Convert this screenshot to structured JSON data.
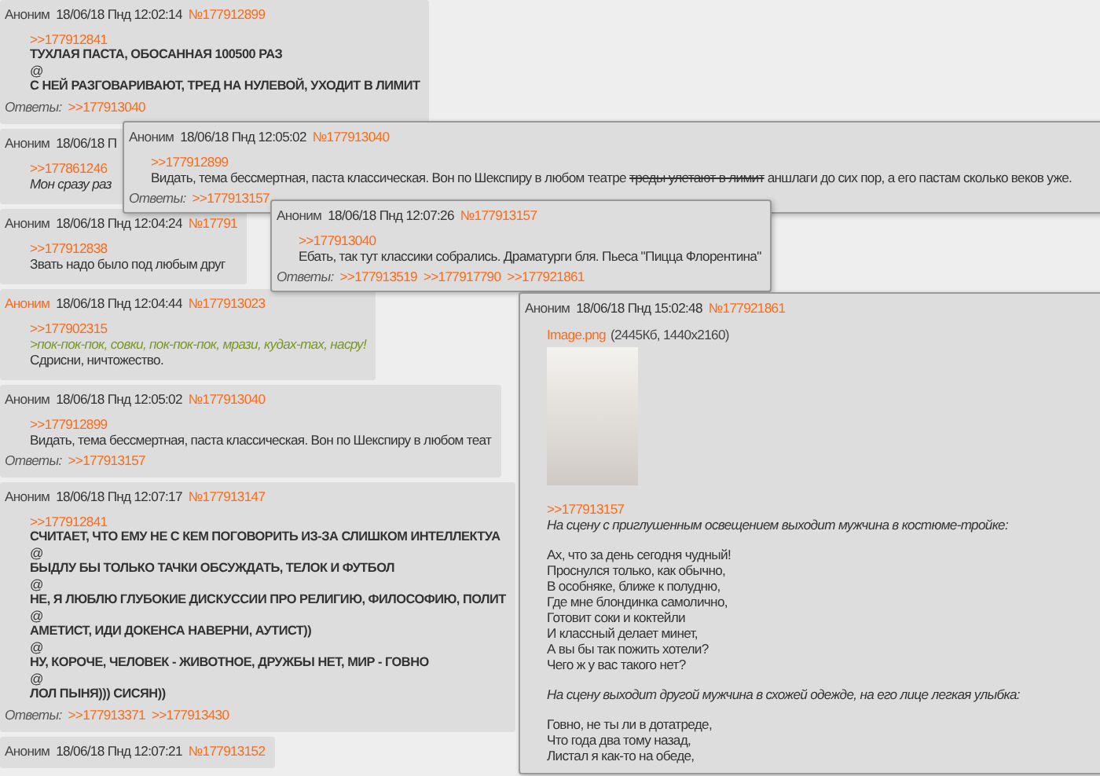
{
  "posts": [
    {
      "name": "Аноним",
      "name_link": false,
      "date": "18/06/18 Пнд 12:02:14",
      "number": "№177912899",
      "blocks": [
        {
          "lines": [
            {
              "kind": "link",
              "text": ">>177912841"
            },
            {
              "kind": "caps",
              "text": "ТУХЛАЯ ПАСТА, ОБОСАННАЯ 100500 РАЗ"
            },
            {
              "kind": "plain",
              "text": "@"
            },
            {
              "kind": "caps",
              "text": "С НЕЙ РАЗГОВАРИВАЮТ, ТРЕД НА НУЛЕВОЙ, УХОДИТ В ЛИМИТ"
            }
          ]
        }
      ],
      "replies_label": "Ответы:",
      "replies": [
        ">>177913040"
      ]
    },
    {
      "name": "Аноним",
      "name_link": false,
      "date": "18/06/18 П",
      "blocks": [
        {
          "lines": [
            {
              "kind": "link",
              "text": ">>177861246"
            },
            {
              "kind": "italic",
              "text": "Мон сразу раз"
            }
          ]
        }
      ]
    },
    {
      "name": "Аноним",
      "name_link": false,
      "date": "18/06/18 Пнд 12:04:24",
      "number": "№17791",
      "blocks": [
        {
          "lines": [
            {
              "kind": "link",
              "text": ">>177912838"
            },
            {
              "kind": "plain",
              "text": "Звать надо было под любым друг"
            }
          ]
        }
      ]
    },
    {
      "name": "Аноним",
      "name_link": true,
      "date": "18/06/18 Пнд 12:04:44",
      "number": "№177913023",
      "blocks": [
        {
          "lines": [
            {
              "kind": "link",
              "text": ">>177902315"
            },
            {
              "kind": "quote",
              "text": ">пок-пок-пок, совки, пок-пок-пок, мрази, кудах-тах, насру!"
            },
            {
              "kind": "plain",
              "text": "Сдрисни, ничтожество."
            }
          ]
        }
      ]
    },
    {
      "name": "Аноним",
      "name_link": false,
      "date": "18/06/18 Пнд 12:05:02",
      "number": "№177913040",
      "blocks": [
        {
          "lines": [
            {
              "kind": "link",
              "text": ">>177912899"
            },
            {
              "kind": "plain",
              "text": "Видать, тема бессмертная, паста классическая. Вон по Шекспиру в любом теат"
            }
          ]
        }
      ],
      "replies_label": "Ответы:",
      "replies": [
        ">>177913157"
      ]
    },
    {
      "name": "Аноним",
      "name_link": false,
      "date": "18/06/18 Пнд 12:07:17",
      "number": "№177913147",
      "blocks": [
        {
          "lines": [
            {
              "kind": "link",
              "text": ">>177912841"
            },
            {
              "kind": "caps",
              "text": "СЧИТАЕТ, ЧТО ЕМУ НЕ С КЕМ ПОГОВОРИТЬ ИЗ-ЗА СЛИШКОМ ИНТЕЛЛЕКТУА"
            },
            {
              "kind": "plain",
              "text": "@"
            },
            {
              "kind": "caps",
              "text": "БЫДЛУ БЫ ТОЛЬКО ТАЧКИ ОБСУЖДАТЬ, ТЕЛОК И ФУТБОЛ"
            },
            {
              "kind": "plain",
              "text": "@"
            },
            {
              "kind": "caps",
              "text": "НЕ, Я ЛЮБЛЮ ГЛУБОКИЕ ДИСКУССИИ ПРО РЕЛИГИЮ, ФИЛОСОФИЮ, ПОЛИТ"
            },
            {
              "kind": "plain",
              "text": "@"
            },
            {
              "kind": "caps",
              "text": "АМЕТИСТ, ИДИ ДОКЕНСА НАВЕРНИ, АУТИСТ))"
            },
            {
              "kind": "plain",
              "text": "@"
            },
            {
              "kind": "caps",
              "text": "НУ, КОРОЧЕ, ЧЕЛОВЕК - ЖИВОТНОЕ, ДРУЖБЫ НЕТ, МИР - ГОВНО"
            },
            {
              "kind": "plain",
              "text": "@"
            },
            {
              "kind": "caps",
              "text": "ЛОЛ ПЫНЯ))) СИСЯН))"
            }
          ]
        }
      ],
      "replies_label": "Ответы:",
      "replies": [
        ">>177913371",
        ">>177913430"
      ]
    },
    {
      "name": "Аноним",
      "name_link": false,
      "date": "18/06/18 Пнд 12:07:21",
      "number": "№177913152"
    }
  ],
  "previews": [
    {
      "name": "Аноним",
      "name_link": false,
      "date": "18/06/18 Пнд 12:05:02",
      "number": "№177913040",
      "blocks": [
        {
          "lines": [
            {
              "kind": "link",
              "text": ">>177912899"
            },
            {
              "kind": "mixed",
              "parts": [
                {
                  "text": "Видать, тема бессмертная, паста классическая. Вон по Шекспиру в любом театре ",
                  "struck": false
                },
                {
                  "text": "треды улетают в лимит",
                  "struck": true
                },
                {
                  "text": " аншлаги до сих пор, а его пастам сколько веков уже.",
                  "struck": false
                }
              ]
            }
          ]
        }
      ],
      "replies_label": "Ответы:",
      "replies": [
        ">>177913157"
      ]
    },
    {
      "name": "Аноним",
      "name_link": false,
      "date": "18/06/18 Пнд 12:07:26",
      "number": "№177913157",
      "blocks": [
        {
          "lines": [
            {
              "kind": "link",
              "text": ">>177913040"
            },
            {
              "kind": "plain",
              "text": "Ебать, так тут классики собрались. Драматурги бля. Пьеса \"Пицца Флорентина\""
            }
          ]
        }
      ],
      "replies_label": "Ответы:",
      "replies": [
        ">>177913519",
        ">>177917790",
        ">>177921861"
      ]
    },
    {
      "name": "Аноним",
      "name_link": false,
      "date": "18/06/18 Пнд 15:02:48",
      "number": "№177921861",
      "file": {
        "name": "Image.png",
        "info": "(2445Кб, 1440x2160)"
      },
      "blocks": [
        {
          "lines": [
            {
              "kind": "link",
              "text": ">>177913157"
            },
            {
              "kind": "italic",
              "text": "На сцену с приглушенным освещением выходит мужчина в костюме-тройке:"
            }
          ]
        },
        {
          "lines": [
            {
              "kind": "plain",
              "text": "Ах, что за день сегодня чудный!"
            },
            {
              "kind": "plain",
              "text": "Проснулся только, как обычно,"
            },
            {
              "kind": "plain",
              "text": "В особняке, ближе к полудню,"
            },
            {
              "kind": "plain",
              "text": "Где мне блондинка самолично,"
            },
            {
              "kind": "plain",
              "text": "Готовит соки и коктейли"
            },
            {
              "kind": "plain",
              "text": "И классный делает минет,"
            },
            {
              "kind": "plain",
              "text": "А вы бы так пожить хотели?"
            },
            {
              "kind": "plain",
              "text": "Чего ж у вас такого нет?"
            }
          ]
        },
        {
          "lines": [
            {
              "kind": "italic",
              "text": "На сцену выходит другой мужчина в схожей одежде, на его лице легкая улыбка:"
            }
          ]
        },
        {
          "lines": [
            {
              "kind": "plain",
              "text": "Говно, не ты ли в дотатреде,"
            },
            {
              "kind": "plain",
              "text": "Что года два тому назад,"
            },
            {
              "kind": "plain",
              "text": "Листал я как-то на обеде,"
            }
          ]
        }
      ]
    }
  ]
}
